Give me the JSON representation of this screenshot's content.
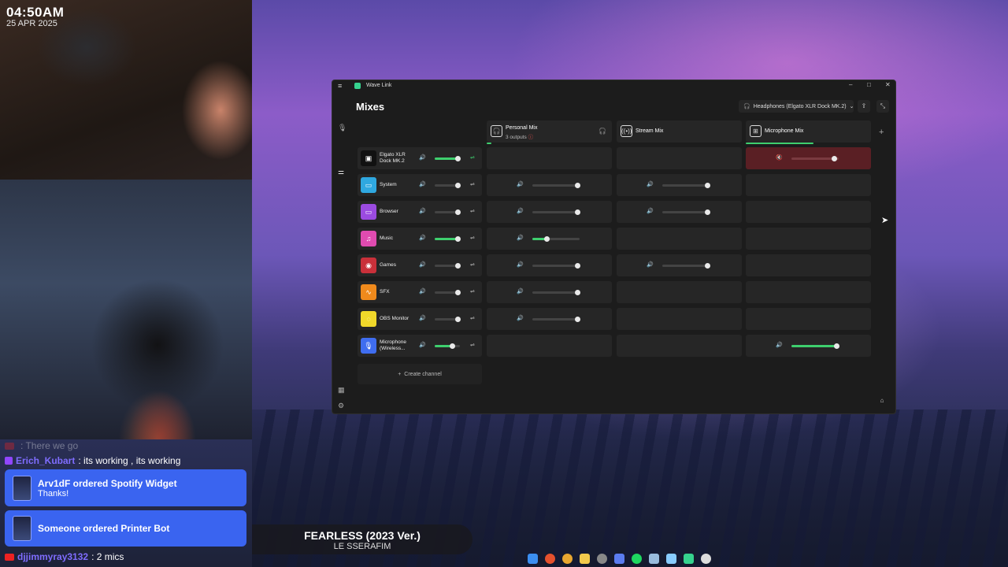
{
  "overlay": {
    "time": "04:50AM",
    "date": "25 APR 2025",
    "chat": [
      {
        "user": "",
        "text": ": There we go",
        "faded": true
      },
      {
        "user": "Erich_Kubart",
        "text": ": its working , its working",
        "faded": false
      }
    ],
    "alerts": [
      {
        "title": "Arv1dF ordered Spotify Widget",
        "subtitle": "Thanks!"
      },
      {
        "title": "Someone ordered Printer Bot",
        "subtitle": ""
      }
    ],
    "last_chat": {
      "user": "djjimmyray3132",
      "text": ": 2 mics"
    },
    "now_playing": {
      "song": "FEARLESS (2023 Ver.)",
      "artist": "LE SSERAFIM"
    }
  },
  "app": {
    "title": "Wave Link",
    "heading": "Mixes",
    "output_device": "Headphones (Elgato XLR Dock MK.2)",
    "mixes": [
      {
        "name": "Personal Mix",
        "subtitle": "3 outputs",
        "icon": "headphones-icon"
      },
      {
        "name": "Stream Mix",
        "subtitle": "",
        "icon": "broadcast-icon"
      },
      {
        "name": "Microphone Mix",
        "subtitle": "",
        "icon": "mixer-icon"
      }
    ],
    "create_channel": "Create channel",
    "channels": [
      {
        "name": "Elgato XLR Dock MK.2",
        "icon_color": "#111111",
        "level": 0.9,
        "linked": true,
        "mix_levels": [
          null,
          null,
          0.9
        ],
        "muted": [
          false,
          false,
          true
        ]
      },
      {
        "name": "System",
        "icon_color": "#2fa8e0",
        "level": 0.9,
        "linked": false,
        "mix_levels": [
          0.95,
          0.95,
          null
        ],
        "muted": [
          false,
          false,
          false
        ]
      },
      {
        "name": "Browser",
        "icon_color": "#9b4be0",
        "level": 0.9,
        "linked": false,
        "mix_levels": [
          0.95,
          0.95,
          null
        ],
        "muted": [
          false,
          false,
          false
        ]
      },
      {
        "name": "Music",
        "icon_color": "#e04bb0",
        "level": 0.9,
        "linked": false,
        "mix_levels": [
          0.3,
          null,
          null
        ],
        "muted": [
          false,
          false,
          false
        ]
      },
      {
        "name": "Games",
        "icon_color": "#c9303a",
        "level": 0.9,
        "linked": false,
        "mix_levels": [
          0.95,
          0.95,
          null
        ],
        "muted": [
          false,
          false,
          false
        ]
      },
      {
        "name": "SFX",
        "icon_color": "#f08a1c",
        "level": 0.9,
        "linked": false,
        "mix_levels": [
          0.95,
          null,
          null
        ],
        "muted": [
          false,
          false,
          false
        ]
      },
      {
        "name": "OBS Monitor",
        "icon_color": "#f0d82a",
        "level": 0.9,
        "linked": false,
        "mix_levels": [
          0.95,
          null,
          null
        ],
        "muted": [
          false,
          false,
          false
        ]
      },
      {
        "name": "Microphone (Wireless...",
        "icon_color": "#3f6df0",
        "level": 0.7,
        "linked": false,
        "mix_levels": [
          null,
          null,
          0.95
        ],
        "muted": [
          false,
          false,
          false
        ]
      }
    ],
    "active_channel_fills": [
      true,
      false,
      false,
      true,
      false,
      false,
      false,
      true
    ]
  }
}
